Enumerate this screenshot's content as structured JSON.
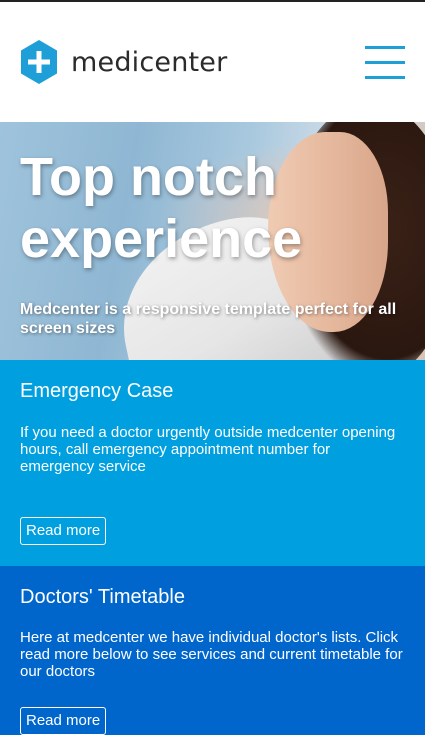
{
  "brand": {
    "name": "medicenter",
    "accent": "#1e9fd8"
  },
  "header": {
    "menu_icon": "hamburger-menu-icon"
  },
  "hero": {
    "title": "Top notch experience",
    "subtitle": "Medcenter is a responsive template perfect for all screen sizes"
  },
  "cards": [
    {
      "title": "Emergency Case",
      "text": "If you need a doctor urgently outside medcenter opening hours, call emergency appointment number for emergency service",
      "button": "Read more",
      "color": "#00a0e0"
    },
    {
      "title": "Doctors' Timetable",
      "text": "Here at medcenter we have individual doctor's lists. Click read more below to see services and current timetable for our doctors",
      "button": "Read more",
      "color": "#0066cc"
    }
  ]
}
